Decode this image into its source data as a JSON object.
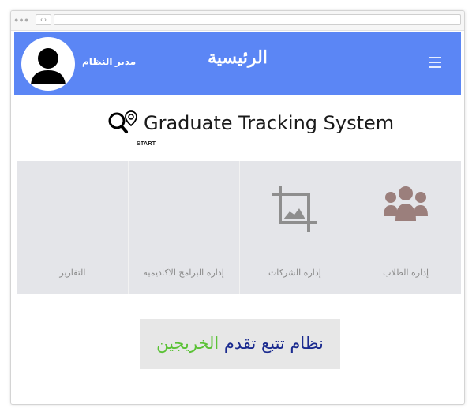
{
  "header": {
    "title": "الرئيسية",
    "user_label": "مدير النظام",
    "menu_icon": "hamburger-icon",
    "background": "#5b86f5"
  },
  "logo": {
    "title": "Graduate Tracking System",
    "subtitle": "START"
  },
  "tiles": [
    {
      "label": "إدارة الطلاب",
      "icon": "users-icon"
    },
    {
      "label": "إدارة الشركات",
      "icon": "crop-icon"
    },
    {
      "label": "إدارة البرامج الاكاديمية",
      "icon": ""
    },
    {
      "label": "التقارير",
      "icon": ""
    }
  ],
  "banner": {
    "text_main": "نظام تتبع تقدم",
    "text_accent": "الخريجين",
    "main_color": "#1b2b8f",
    "accent_color": "#5bc236"
  }
}
